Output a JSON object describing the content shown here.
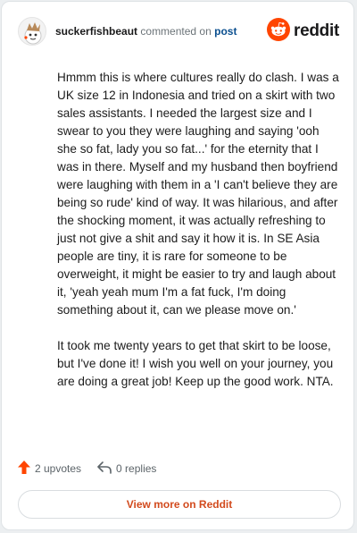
{
  "header": {
    "username": "suckerfishbeaut",
    "action_text": "commented on",
    "post_link": "post",
    "brand": "reddit"
  },
  "comment": {
    "paragraphs": [
      "Hmmm this is where cultures really do clash. I was a UK size 12 in Indonesia and tried on a skirt with two sales assistants. I needed the largest size and I swear to you they were laughing and saying 'ooh she so fat, lady you so fat...' for the eternity that I was in there. Myself and my husband then boyfriend were laughing with them in a 'I can't believe they are being so rude' kind of way. It was hilarious, and after the shocking moment, it was actually refreshing to just not give a shit and say it how it is. In SE Asia people are tiny, it is rare for someone to be overweight, it might be easier to try and laugh about it, 'yeah yeah mum I'm a fat fuck, I'm doing something about it, can we please move on.'",
      "It took me twenty years to get that skirt to be loose, but I've done it! I wish you well on your journey, you are doing a great job! Keep up the good work. NTA."
    ]
  },
  "footer": {
    "upvotes": "2 upvotes",
    "replies": "0 replies",
    "view_more": "View more on Reddit"
  },
  "icons": {
    "upvote": "upvote-arrow-icon",
    "reply": "reply-arrow-icon",
    "brand": "reddit-snoo-icon"
  },
  "colors": {
    "accent": "#ff4500",
    "link": "#0a4f8f",
    "view_more": "#d24a1d"
  }
}
